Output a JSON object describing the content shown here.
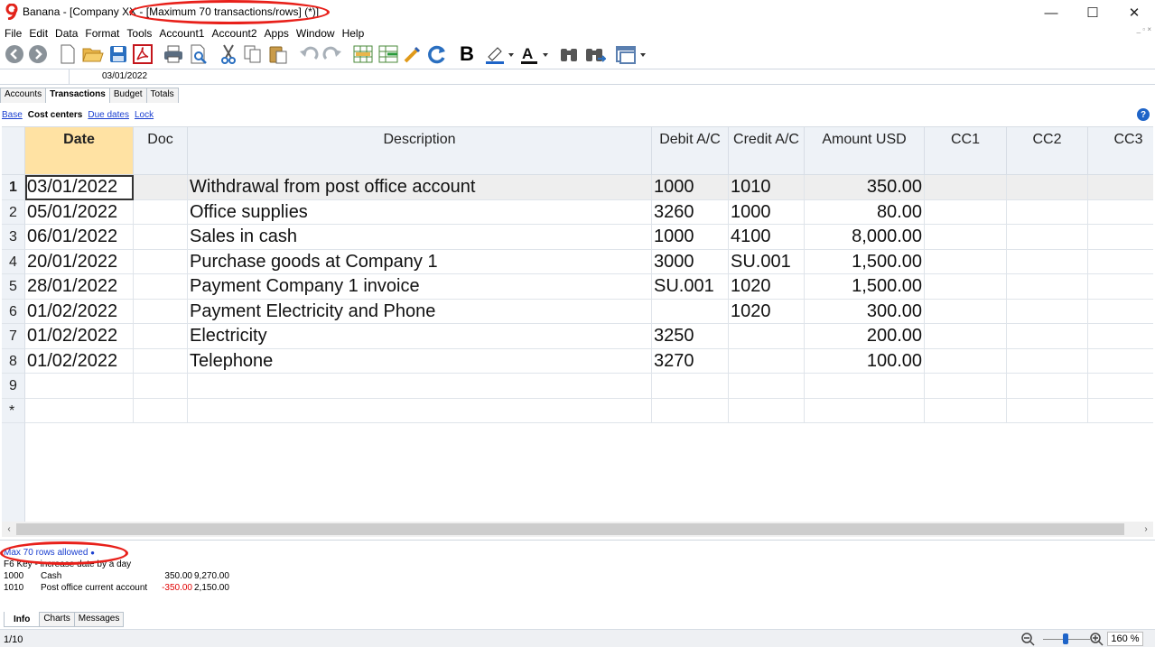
{
  "window": {
    "title": "Banana - [Company XX - [Maximum 70 transactions/rows] (*)]",
    "minimize": "—",
    "maximize": "☐",
    "close": "✕"
  },
  "menu": [
    "File",
    "Edit",
    "Data",
    "Format",
    "Tools",
    "Account1",
    "Account2",
    "Apps",
    "Window",
    "Help"
  ],
  "editline": {
    "value": "03/01/2022"
  },
  "tabs": [
    "Accounts",
    "Transactions",
    "Budget",
    "Totals"
  ],
  "views": {
    "base": "Base",
    "current": "Cost centers",
    "due": "Due dates",
    "lock": "Lock"
  },
  "columns": {
    "date": "Date",
    "doc": "Doc",
    "description": "Description",
    "debit": "Debit A/C",
    "credit": "Credit A/C",
    "amount": "Amount USD",
    "cc1": "CC1",
    "cc2": "CC2",
    "cc3": "CC3"
  },
  "rows": [
    {
      "n": "1",
      "date": "03/01/2022",
      "doc": "",
      "desc": "Withdrawal from post office account",
      "debit": "1000",
      "credit": "1010",
      "amount": "350.00"
    },
    {
      "n": "2",
      "date": "05/01/2022",
      "doc": "",
      "desc": "Office supplies",
      "debit": "3260",
      "credit": "1000",
      "amount": "80.00"
    },
    {
      "n": "3",
      "date": "06/01/2022",
      "doc": "",
      "desc": "Sales in cash",
      "debit": "1000",
      "credit": "4100",
      "amount": "8,000.00"
    },
    {
      "n": "4",
      "date": "20/01/2022",
      "doc": "",
      "desc": "Purchase goods at Company 1",
      "debit": "3000",
      "credit": "SU.001",
      "amount": "1,500.00"
    },
    {
      "n": "5",
      "date": "28/01/2022",
      "doc": "",
      "desc": "Payment Company 1 invoice",
      "debit": "SU.001",
      "credit": "1020",
      "amount": "1,500.00"
    },
    {
      "n": "6",
      "date": "01/02/2022",
      "doc": "",
      "desc": "Payment Electricity and Phone",
      "debit": "",
      "credit": "1020",
      "amount": "300.00"
    },
    {
      "n": "7",
      "date": "01/02/2022",
      "doc": "",
      "desc": "Electricity",
      "debit": "3250",
      "credit": "",
      "amount": "200.00"
    },
    {
      "n": "8",
      "date": "01/02/2022",
      "doc": "",
      "desc": "Telephone",
      "debit": "3270",
      "credit": "",
      "amount": "100.00"
    },
    {
      "n": "9",
      "date": "",
      "doc": "",
      "desc": "",
      "debit": "",
      "credit": "",
      "amount": ""
    },
    {
      "n": "*",
      "date": "",
      "doc": "",
      "desc": "",
      "debit": "",
      "credit": "",
      "amount": ""
    }
  ],
  "info": {
    "message": "Max 70 rows allowed",
    "message_icon": "●",
    "hint": "F6 Key - increase date by a day",
    "balances": [
      {
        "account": "1000",
        "name": "Cash",
        "change": "350.00",
        "balance": "9,270.00",
        "negative": false
      },
      {
        "account": "1010",
        "name": "Post office current account",
        "change": "-350.00",
        "balance": "2,150.00",
        "negative": true
      }
    ]
  },
  "bottom_tabs": [
    "Info",
    "Charts",
    "Messages"
  ],
  "status": {
    "position": "1/10",
    "zoom": "160 %",
    "zoom_level_percent": 160
  },
  "colors": {
    "highlight_oval": "#e8201a",
    "link": "#1a3fd0",
    "date_header": "#ffe2a3",
    "accent_blue": "#1e64c8"
  }
}
